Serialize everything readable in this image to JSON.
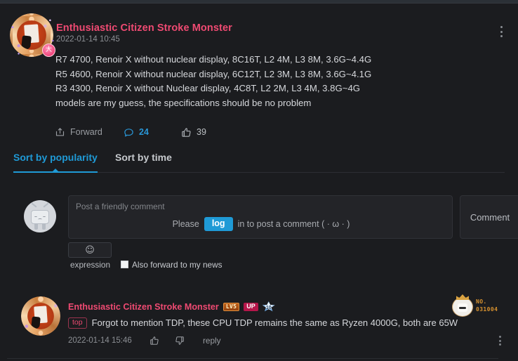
{
  "post": {
    "author": "Enthusiastic Citizen Stroke Monster",
    "timestamp": "2022-01-14 10:45",
    "avatar_icon": "ornate-orange-avatar",
    "avatar_pendant_icon": "pink-circle-pendant",
    "lines": [
      "R7 4700, Renoir X without nuclear display, 8C16T, L2 4M, L3 8M, 3.6G~4.4G",
      "R5 4600, Renoir X without nuclear display, 6C12T, L2 3M, L3 8M, 3.6G~4.1G",
      "R3 4300, Renoir X without Nuclear display, 4C8T, L2 2M, L3 4M, 3.8G~4G",
      "models are my guess, the specifications should be no problem"
    ],
    "actions": {
      "forward_label": "Forward",
      "forward_icon": "share-icon",
      "comment_count": "24",
      "comment_icon": "comment-bubble-icon",
      "like_count": "39",
      "like_icon": "thumbs-up-icon"
    },
    "menu_icon": "kebab-menu-icon"
  },
  "tabs": {
    "items": [
      {
        "label": "Sort by popularity",
        "active": true
      },
      {
        "label": "Sort by time",
        "active": false
      }
    ]
  },
  "comment_form": {
    "avatar_icon": "default-tv-mascot-avatar",
    "placeholder": "Post a friendly comment",
    "login_prefix": "Please",
    "login_button": "log",
    "login_suffix": "in to post a comment ( · ω · )",
    "submit_label": "Comment",
    "expression_icon": "smiley-face-icon",
    "expression_label": "expression",
    "forward_checkbox_label": "Also forward to my news",
    "forward_checkbox_checked": true
  },
  "comments": [
    {
      "author": "Enthusiastic Citizen Stroke Monster",
      "avatar_icon": "ornate-orange-avatar",
      "level_badge": "LV5",
      "up_badge": "UP",
      "star_badge": "10",
      "star_badge_icon": "blue-star-level-icon",
      "frame_badge_icon": "chibi-crown-avatar-frame",
      "frame_badge_prefix": "NO.",
      "frame_badge_number": "031004",
      "top_tag": "top",
      "text": "Forgot to mention TDP, these CPU TDP remains the same as Ryzen 4000G, both are 65W",
      "timestamp": "2022-01-14 15:46",
      "like_icon": "thumbs-up-icon",
      "dislike_icon": "thumbs-down-icon",
      "reply_label": "reply",
      "menu_icon": "kebab-menu-icon"
    }
  ],
  "colors": {
    "background": "#1b1c1f",
    "accent_blue": "#1f9ad6",
    "accent_pink": "#ef4a72",
    "text_primary": "#d6d8dc",
    "text_secondary": "#8c8f94"
  }
}
